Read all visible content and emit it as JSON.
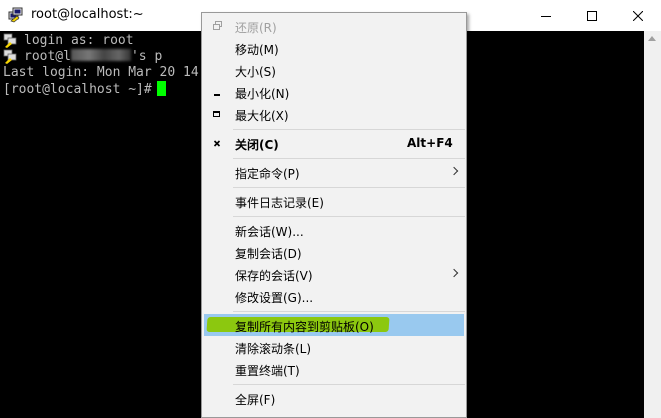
{
  "window": {
    "title": "root@localhost:~"
  },
  "terminal": {
    "lines": {
      "login_as": "login as: root",
      "pass_prefix": "root@l",
      "pass_suffix": "'s p",
      "last_login": "Last login: Mon Mar 20 14",
      "prompt": "[root@localhost ~]#"
    },
    "cursor_color": "#00ff00"
  },
  "menu": {
    "items": [
      {
        "label": "还原(R)",
        "disabled": true,
        "icon": "restore-icon"
      },
      {
        "label": "移动(M)"
      },
      {
        "label": "大小(S)"
      },
      {
        "label": "最小化(N)",
        "icon": "minimize-icon"
      },
      {
        "label": "最大化(X)",
        "icon": "maximize-icon"
      },
      {
        "label": "关闭(C)",
        "shortcut": "Alt+F4",
        "bold": true,
        "icon": "close-icon"
      },
      {
        "label": "指定命令(P)",
        "submenu": true
      },
      {
        "label": "事件日志记录(E)"
      },
      {
        "label": "新会话(W)..."
      },
      {
        "label": "复制会话(D)"
      },
      {
        "label": "保存的会话(V)",
        "submenu": true
      },
      {
        "label": "修改设置(G)..."
      },
      {
        "label": "复制所有内容到剪贴板(O)",
        "highlighted": true
      },
      {
        "label": "清除滚动条(L)"
      },
      {
        "label": "重置终端(T)"
      },
      {
        "label": "全屏(F)"
      }
    ],
    "highlight_color": "#99c9ef",
    "marker_color": "#8cc80f"
  }
}
